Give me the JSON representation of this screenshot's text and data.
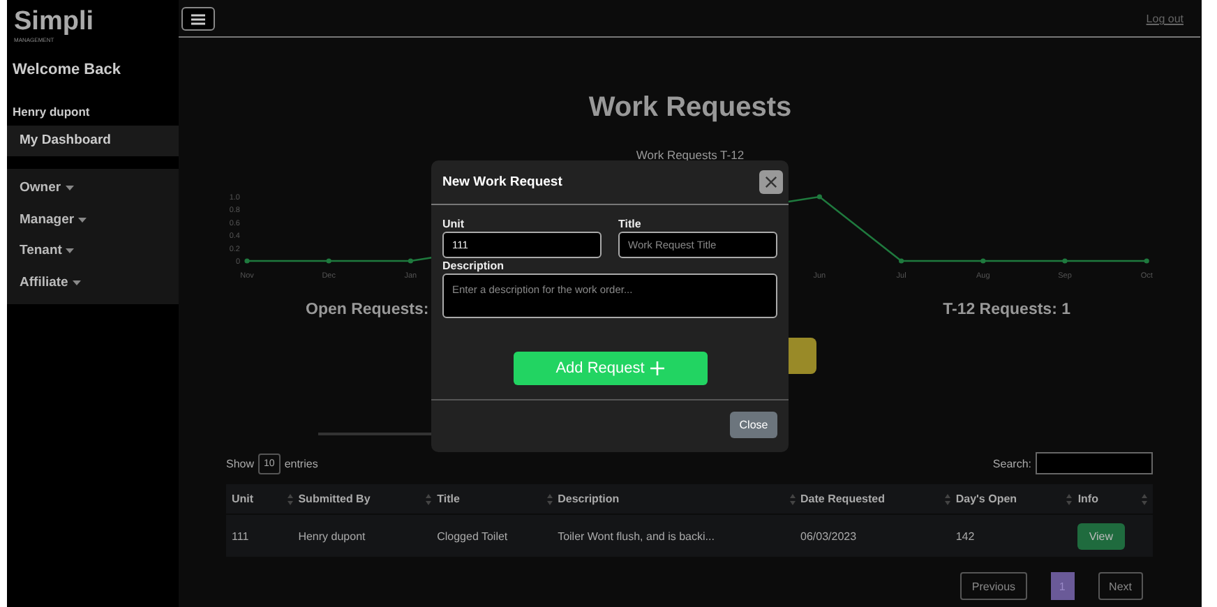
{
  "sidebar": {
    "logo": "Simpli",
    "logo_sub": "MANAGEMENT",
    "welcome": "Welcome Back",
    "user": "Henry dupont",
    "links": [
      {
        "label": "My Dashboard"
      }
    ],
    "menus": [
      {
        "label": "Owner"
      },
      {
        "label": "Manager"
      },
      {
        "label": "Tenant"
      },
      {
        "label": "Affiliate"
      }
    ]
  },
  "topbar": {
    "logout": "Log out"
  },
  "page": {
    "title": "Work Requests",
    "chart": {
      "chart_data": {
        "type": "line",
        "title": "Work Requests T-12",
        "categories": [
          "Nov",
          "Dec",
          "Jan",
          null,
          null,
          null,
          null,
          "Jun",
          "Jul",
          "Aug",
          "Sep",
          "Oct"
        ],
        "series": [
          {
            "color": "#1f7a3e",
            "marker": true,
            "values": [
              0,
              0,
              0,
              null,
              null,
              null,
              null,
              1,
              0,
              0,
              0,
              0
            ]
          }
        ],
        "ylim": [
          0,
          1
        ],
        "yticks": [
          {
            "value": 0,
            "label": "0"
          },
          {
            "value": 0.2,
            "label": "0.2"
          },
          {
            "value": 0.4,
            "label": "0.4"
          },
          {
            "value": 0.6,
            "label": "0.6"
          },
          {
            "value": 0.8,
            "label": "0.8"
          },
          {
            "value": 1,
            "label": "1.0"
          }
        ]
      }
    },
    "open_requests": "Open Requests:",
    "t12_requests": "T-12 Requests: 1"
  },
  "table": {
    "show_label": "Show",
    "entries_value": "10",
    "entries_label": "entries",
    "search_label": "Search:",
    "columns": [
      "Unit",
      "Submitted By",
      "Title",
      "Description",
      "Date Requested",
      "Day's Open",
      "Info"
    ],
    "rows": [
      {
        "cells": [
          "111",
          "Henry dupont",
          "Clogged Toilet",
          "Toiler Wont flush, and is backi...",
          "06/03/2023",
          "142"
        ],
        "action": "View"
      }
    ]
  },
  "pagination": {
    "previous": "Previous",
    "pages": [
      {
        "label": "1",
        "selected": true
      }
    ],
    "next": "Next"
  },
  "modal": {
    "title": "New Work Request",
    "unit_label": "Unit",
    "unit_value": "111",
    "title_label": "Title",
    "title_placeholder": "Work Request Title",
    "description_label": "Description",
    "description_placeholder": "Enter a description for the work order...",
    "submit": "Add Request",
    "close": "Close"
  }
}
